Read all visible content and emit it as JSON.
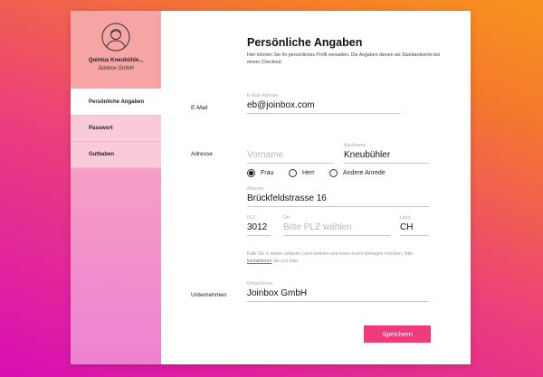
{
  "profile": {
    "name": "Quintus Kneubühle...",
    "company": "Joinbox GmbH"
  },
  "nav": [
    {
      "label": "Persönliche Angaben",
      "active": true
    },
    {
      "label": "Passwort",
      "active": false
    },
    {
      "label": "Guthaben",
      "active": false
    }
  ],
  "header": {
    "title": "Persönliche Angaben",
    "description": "Hier können Sie Ihr persönliches Profil verwalten. Die Angaben dienen als Standardwerte bei einem Checkout."
  },
  "email": {
    "section": "E-Mail",
    "label": "E-Mail-Adresse",
    "value": "eb@joinbox.com"
  },
  "address": {
    "section": "Adresse",
    "firstname_placeholder": "Vorname",
    "lastname_label": "Nachname",
    "lastname_value": "Kneubühler",
    "salutations": [
      {
        "label": "Frau",
        "selected": true
      },
      {
        "label": "Herr",
        "selected": false
      },
      {
        "label": "Andere Anrede",
        "selected": false
      }
    ],
    "street_label": "Adresse",
    "street_value": "Brückfeldstrasse 16",
    "zip_label": "PLZ",
    "zip_value": "3012",
    "city_label": "Ort",
    "city_placeholder": "Bitte PLZ wählen",
    "country_label": "Land",
    "country_value": "CH",
    "note_before": "Falls Sie in einem anderen Land wohnen und einen Event eintragen möchten, bitte ",
    "note_link": "kontaktieren",
    "note_after": " Sie uns bitte."
  },
  "company": {
    "section": "Unternehmen",
    "label": "Firma/Verein",
    "value": "Joinbox GmbH"
  },
  "actions": {
    "save_label": "Speichern"
  },
  "colors": {
    "accent": "#ef3b7c",
    "profile_bg": "#f6a4a4",
    "nav_bg": "#f9cbd9"
  }
}
